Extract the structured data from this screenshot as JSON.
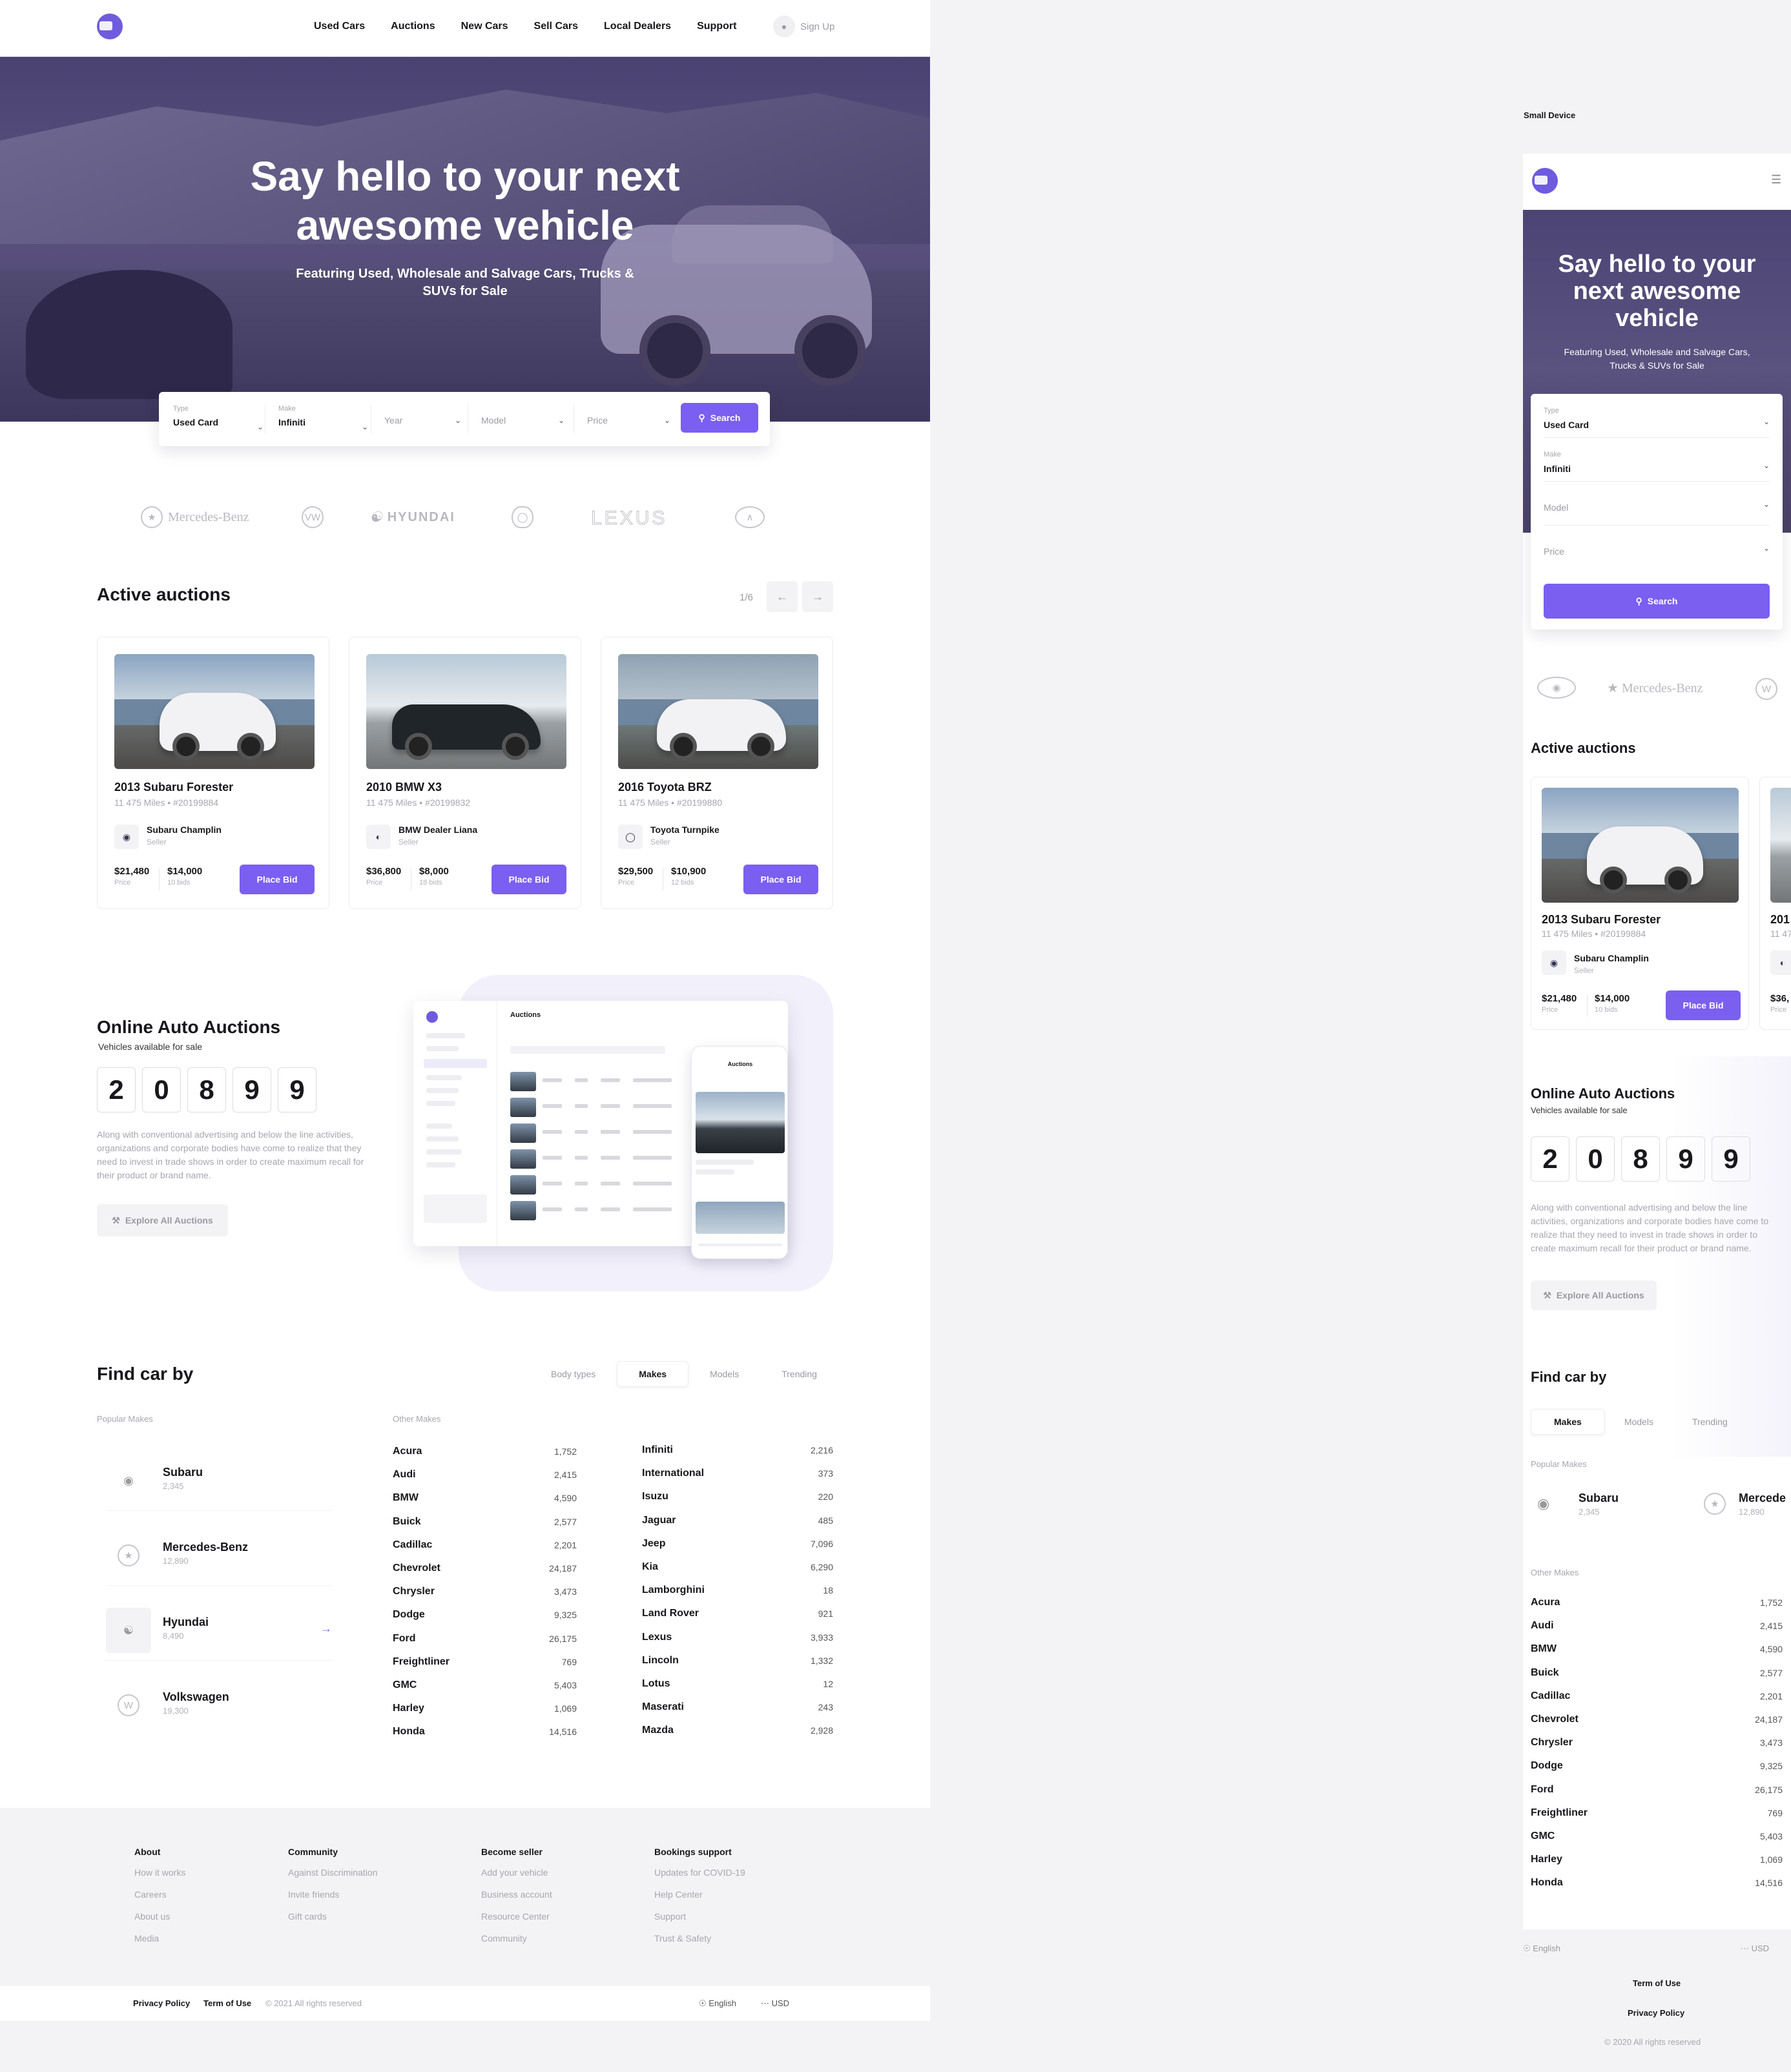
{
  "nav": {
    "items": [
      "Used Cars",
      "Auctions",
      "New Cars",
      "Sell Cars",
      "Local Dealers",
      "Support"
    ],
    "signup": "Sign Up"
  },
  "hero": {
    "title": "Say hello to your next awesome vehicle",
    "subtitle": "Featuring Used, Wholesale and Salvage Cars, Trucks & SUVs for Sale"
  },
  "search": {
    "type_label": "Type",
    "type_value": "Used Card",
    "make_label": "Make",
    "make_value": "Infiniti",
    "year": "Year",
    "model": "Model",
    "price": "Price",
    "button": "Search"
  },
  "brands": [
    "Mercedes-Benz",
    "VW",
    "HYUNDAI",
    "Toyota",
    "LEXUS",
    "Infiniti"
  ],
  "auctions": {
    "title": "Active auctions",
    "pager": "1/6",
    "cards": [
      {
        "name": "2013 Subaru Forester",
        "miles": "11 475 Miles",
        "id": "#20199884",
        "seller": "Subaru Champlin",
        "role": "Seller",
        "price": "$21,480",
        "price_label": "Price",
        "bid": "$14,000",
        "bids": "10 bids",
        "button": "Place Bid"
      },
      {
        "name": "2010 BMW X3",
        "miles": "11 475 Miles",
        "id": "#20199832",
        "seller": "BMW Dealer Liana",
        "role": "Seller",
        "price": "$36,800",
        "price_label": "Price",
        "bid": "$8,000",
        "bids": "18 bids",
        "button": "Place Bid"
      },
      {
        "name": "2016 Toyota BRZ",
        "miles": "11 475 Miles",
        "id": "#20199880",
        "seller": "Toyota Turnpike",
        "role": "Seller",
        "price": "$29,500",
        "price_label": "Price",
        "bid": "$10,900",
        "bids": "12 bids",
        "button": "Place Bid"
      }
    ]
  },
  "online": {
    "title": "Online Auto Auctions",
    "subtitle": "Vehicles available for sale",
    "digits": [
      "2",
      "0",
      "8",
      "9",
      "9"
    ],
    "text": "Along with conventional advertising and below the line activities, organizations and corporate bodies have come to realize that they need to invest in trade shows in order to create maximum recall for their product or brand name.",
    "button": "Explore All Auctions",
    "illus_title": "Auctions",
    "illus_phone_title": "Auctions"
  },
  "find": {
    "title": "Find car by",
    "tabs": [
      "Body types",
      "Makes",
      "Models",
      "Trending"
    ],
    "popular_label": "Popular Makes",
    "other_label": "Other Makes",
    "popular": [
      {
        "name": "Subaru",
        "count": "2,345"
      },
      {
        "name": "Mercedes-Benz",
        "count": "12,890"
      },
      {
        "name": "Hyundai",
        "count": "8,490"
      },
      {
        "name": "Volkswagen",
        "count": "19,300"
      }
    ],
    "other_left": [
      {
        "name": "Acura",
        "count": "1,752"
      },
      {
        "name": "Audi",
        "count": "2,415"
      },
      {
        "name": "BMW",
        "count": "4,590"
      },
      {
        "name": "Buick",
        "count": "2,577"
      },
      {
        "name": "Cadillac",
        "count": "2,201"
      },
      {
        "name": "Chevrolet",
        "count": "24,187"
      },
      {
        "name": "Chrysler",
        "count": "3,473"
      },
      {
        "name": "Dodge",
        "count": "9,325"
      },
      {
        "name": "Ford",
        "count": "26,175"
      },
      {
        "name": "Freightliner",
        "count": "769"
      },
      {
        "name": "GMC",
        "count": "5,403"
      },
      {
        "name": "Harley",
        "count": "1,069"
      },
      {
        "name": "Honda",
        "count": "14,516"
      }
    ],
    "other_right": [
      {
        "name": "Infiniti",
        "count": "2,216"
      },
      {
        "name": "International",
        "count": "373"
      },
      {
        "name": "Isuzu",
        "count": "220"
      },
      {
        "name": "Jaguar",
        "count": "485"
      },
      {
        "name": "Jeep",
        "count": "7,096"
      },
      {
        "name": "Kia",
        "count": "6,290"
      },
      {
        "name": "Lamborghini",
        "count": "18"
      },
      {
        "name": "Land Rover",
        "count": "921"
      },
      {
        "name": "Lexus",
        "count": "3,933"
      },
      {
        "name": "Lincoln",
        "count": "1,332"
      },
      {
        "name": "Lotus",
        "count": "12"
      },
      {
        "name": "Maserati",
        "count": "243"
      },
      {
        "name": "Mazda",
        "count": "2,928"
      }
    ]
  },
  "footer": {
    "columns": [
      {
        "title": "About",
        "links": [
          "How it works",
          "Careers",
          "About us",
          "Media"
        ]
      },
      {
        "title": "Community",
        "links": [
          "Against Discrimination",
          "Invite friends",
          "Gift cards"
        ]
      },
      {
        "title": "Become seller",
        "links": [
          "Add your vehicle",
          "Business account",
          "Resource Center",
          "Community"
        ]
      },
      {
        "title": "Bookings support",
        "links": [
          "Updates for COVID-19",
          "Help Center",
          "Support",
          "Trust & Safety"
        ]
      }
    ],
    "privacy": "Privacy Policy",
    "terms": "Term of Use",
    "copyright": "© 2021 All rights reserved",
    "language": "English",
    "currency": "USD"
  },
  "mobile": {
    "label": "Small Device",
    "hero_title": "Say hello to your next awesome vehicle",
    "hero_subtitle": "Featuring Used, Wholesale and Salvage Cars, Trucks & SUVs for Sale",
    "type_label": "Type",
    "type_value": "Used Card",
    "make_label": "Make",
    "make_value": "Infiniti",
    "model": "Model",
    "price": "Price",
    "search": "Search",
    "brands": [
      "Subaru",
      "Mercedes-Benz",
      "VW"
    ],
    "auctions_title": "Active auctions",
    "card": {
      "name": "2013 Subaru Forester",
      "miles": "11 475 Miles",
      "id": "#20199884",
      "seller": "Subaru Champlin",
      "role": "Seller",
      "price": "$21,480",
      "price_label": "Price",
      "bid": "$14,000",
      "bids": "10 bids",
      "button": "Place Bid"
    },
    "card2": {
      "name": "201",
      "miles": "11 47",
      "price": "$36,",
      "price_label": "Price"
    },
    "online_title": "Online Auto Auctions",
    "online_sub": "Vehicles available for sale",
    "digits": [
      "2",
      "0",
      "8",
      "9",
      "9"
    ],
    "text": "Along with conventional advertising and below the line activities, organizations and corporate bodies have come to realize that they need to invest in trade shows in order to create maximum recall for their product or brand name.",
    "explore": "Explore All Auctions",
    "find_title": "Find car by",
    "tabs": [
      "Makes",
      "Models",
      "Trending"
    ],
    "popular_label": "Popular Makes",
    "popular": [
      {
        "name": "Subaru",
        "count": "2,345"
      },
      {
        "name": "Mercede",
        "count": "12,890"
      }
    ],
    "other_label": "Other Makes",
    "other": [
      {
        "name": "Acura",
        "count": "1,752"
      },
      {
        "name": "Audi",
        "count": "2,415"
      },
      {
        "name": "BMW",
        "count": "4,590"
      },
      {
        "name": "Buick",
        "count": "2,577"
      },
      {
        "name": "Cadillac",
        "count": "2,201"
      },
      {
        "name": "Chevrolet",
        "count": "24,187"
      },
      {
        "name": "Chrysler",
        "count": "3,473"
      },
      {
        "name": "Dodge",
        "count": "9,325"
      },
      {
        "name": "Ford",
        "count": "26,175"
      },
      {
        "name": "Freightliner",
        "count": "769"
      },
      {
        "name": "GMC",
        "count": "5,403"
      },
      {
        "name": "Harley",
        "count": "1,069"
      },
      {
        "name": "Honda",
        "count": "14,516"
      }
    ],
    "language": "English",
    "currency": "USD",
    "terms": "Term of Use",
    "privacy": "Privacy Policy",
    "copyright": "© 2020 All rights reserved"
  },
  "colors": {
    "accent": "#7a5ff0",
    "logo": "#6e5bde",
    "hero": "#4f4874"
  }
}
